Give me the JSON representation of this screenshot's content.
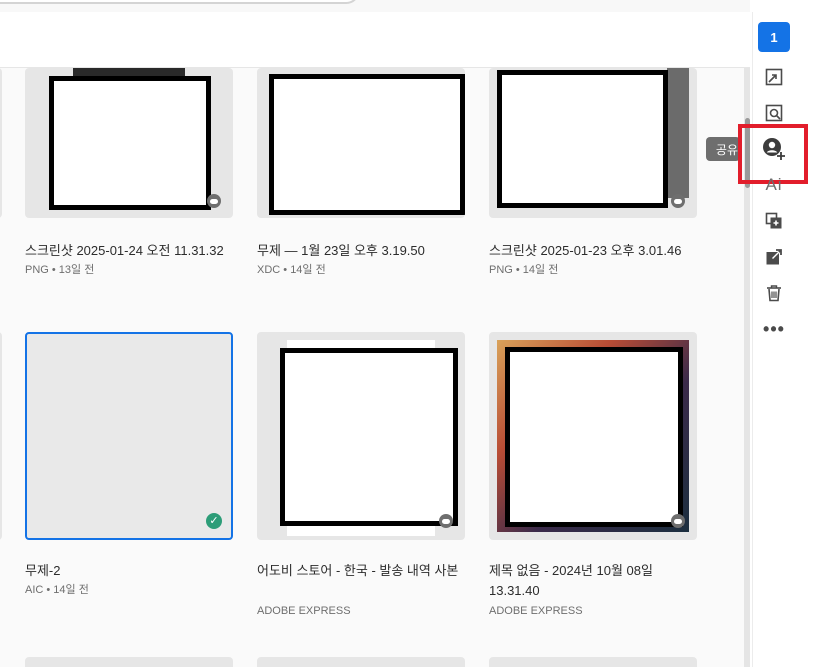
{
  "selection": {
    "count": "1"
  },
  "tooltip": {
    "text": "공유"
  },
  "actions": {
    "ai_label": "Ai",
    "more_label": "•••"
  },
  "files": [
    {
      "title": "스크린샷 2025-01-24 오전 11.31.32",
      "meta": "PNG • 13일 전",
      "synced": true
    },
    {
      "title": "무제 — 1월 23일 오후 3.19.50",
      "meta": "XDC • 14일 전",
      "synced": false
    },
    {
      "title": "스크린샷 2025-01-23 오후 3.01.46",
      "meta": "PNG • 14일 전",
      "synced": true
    },
    {
      "title": "무제-2",
      "meta": "AIC • 14일 전",
      "selected": true
    },
    {
      "title": "어도비 스토어 - 한국 - 발송 내역 사본",
      "meta": "ADOBE EXPRESS",
      "synced": true
    },
    {
      "title": "제목 없음 - 2024년 10월 08일 13.31.40",
      "meta": "ADOBE EXPRESS",
      "synced": true
    }
  ],
  "colors": {
    "accent": "#1473e6",
    "highlight": "#e21d2b",
    "success": "#2d9d78"
  }
}
